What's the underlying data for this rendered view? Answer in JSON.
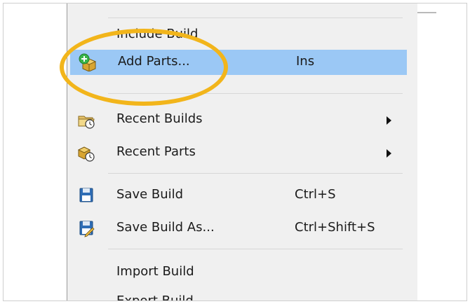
{
  "menu": {
    "items": [
      {
        "label": "Include Build",
        "shortcut": "",
        "submenu": false,
        "icon": "none"
      },
      {
        "label": "Add Parts...",
        "shortcut": "Ins",
        "submenu": false,
        "icon": "add-parts-icon"
      },
      {
        "label": "Recent Builds",
        "shortcut": "",
        "submenu": true,
        "icon": "folder-clock-icon"
      },
      {
        "label": "Recent Parts",
        "shortcut": "",
        "submenu": true,
        "icon": "parts-clock-icon"
      },
      {
        "label": "Save Build",
        "shortcut": "Ctrl+S",
        "submenu": false,
        "icon": "floppy-icon"
      },
      {
        "label": "Save Build As...",
        "shortcut": "Ctrl+Shift+S",
        "submenu": false,
        "icon": "floppy-pencil-icon"
      },
      {
        "label": "Import Build",
        "shortcut": "",
        "submenu": false,
        "icon": "none"
      },
      {
        "label": "Export Build",
        "shortcut": "",
        "submenu": false,
        "icon": "none"
      }
    ],
    "highlighted_item": "Add Parts..."
  },
  "colors": {
    "annotation_circle": "#f2b51b",
    "menu_highlight": "#9bc8f5",
    "menu_background": "#f0f0f0"
  }
}
